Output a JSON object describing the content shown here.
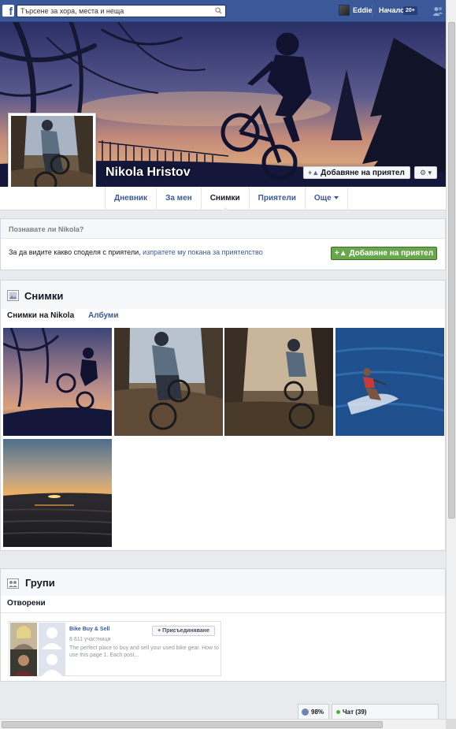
{
  "topbar": {
    "logo": "f",
    "search_placeholder": "Търсене за хора, места и неща",
    "user_name": "Eddie",
    "home_label": "Начало",
    "home_badge": "20+"
  },
  "profile": {
    "name": "Nikola Hristov",
    "add_friend_label": "Добавяне на приятел",
    "gear_label": "⚙ ▾"
  },
  "tabs": [
    {
      "label": "Дневник"
    },
    {
      "label": "За мен"
    },
    {
      "label": "Снимки"
    },
    {
      "label": "Приятели"
    },
    {
      "label": "Още"
    }
  ],
  "know": {
    "heading": "Познавате ли Nikola?",
    "text_prefix": "За да видите какво споделя с приятели, ",
    "text_link": "изпратете му покана за приятелство",
    "button_label": "Добавяне на приятел"
  },
  "photos": {
    "title": "Снимки",
    "tab_nikola": "Снимки на Nikola",
    "tab_albums": "Албуми"
  },
  "groups": {
    "title": "Групи",
    "subtitle": "Отворени",
    "group": {
      "name": "Bike Buy & Sell",
      "members": "8 611 участници",
      "description": "The perfect place to buy and sell your used bike gear. How to use this page 1. Each post...",
      "join_label": "Присъединяване"
    }
  },
  "status": {
    "globe_value": "98%",
    "chat_label": "Чат (39)"
  },
  "colors": {
    "brand_blue": "#3b5998",
    "green_button": "#69a74e",
    "online_green": "#42b72a"
  }
}
